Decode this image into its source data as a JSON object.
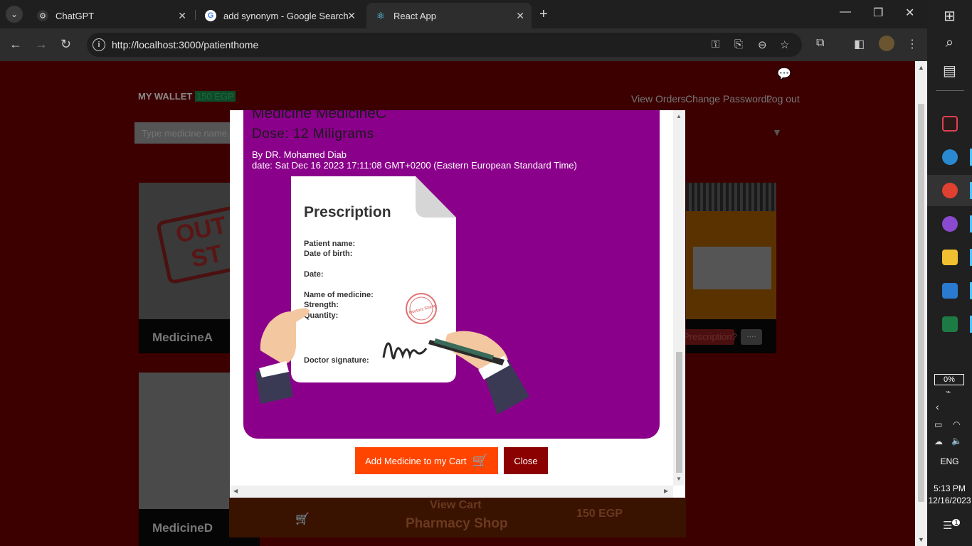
{
  "browser": {
    "tabs": [
      {
        "title": "ChatGPT",
        "active": false
      },
      {
        "title": "add synonym - Google Search",
        "active": false
      },
      {
        "title": "React App",
        "active": true
      }
    ],
    "url": "http://localhost:3000/patienthome"
  },
  "page": {
    "wallet_label": "MY WALLET",
    "wallet_value": "150 EGP",
    "links": [
      "View Orders",
      "Change Password?",
      "Log out"
    ],
    "search_placeholder": "Type medicine name...",
    "cards": [
      {
        "name": "MedicineA",
        "stamp": "OUT OF STOCK"
      },
      {
        "name": "MedicineD"
      }
    ],
    "prescription_btn": "Prescription?",
    "dots_btn": "....",
    "cart_bar": {
      "view_cart": "View Cart",
      "shop_name": "Pharmacy Shop",
      "total": "150 EGP"
    }
  },
  "modal": {
    "title": "Medicine MedicineC",
    "dose": "Dose: 12 Miligrams",
    "by": "By DR. Mohamed Diab",
    "date": "date: Sat Dec 16 2023 17:11:08 GMT+0200 (Eastern European Standard Time)",
    "illustration": {
      "heading": "Prescription",
      "fields": [
        "Patient name:",
        "Date of birth:",
        "Date:",
        "Name of medicine:",
        "Strength:",
        "Quantity:"
      ],
      "signature_label": "Doctor signature:",
      "stamp_text": "Doctors Stamp"
    },
    "add_button": "Add Medicine to my Cart",
    "close_button": "Close"
  },
  "taskbar": {
    "battery": "0%",
    "language": "ENG",
    "time": "5:13 PM",
    "date": "12/16/2023",
    "notifications": "1"
  },
  "colors": {
    "modal_content_bg": "#8b008b",
    "add_button": "#ff4500",
    "close_button": "#8b0000",
    "page_bg": "#3c0000"
  }
}
